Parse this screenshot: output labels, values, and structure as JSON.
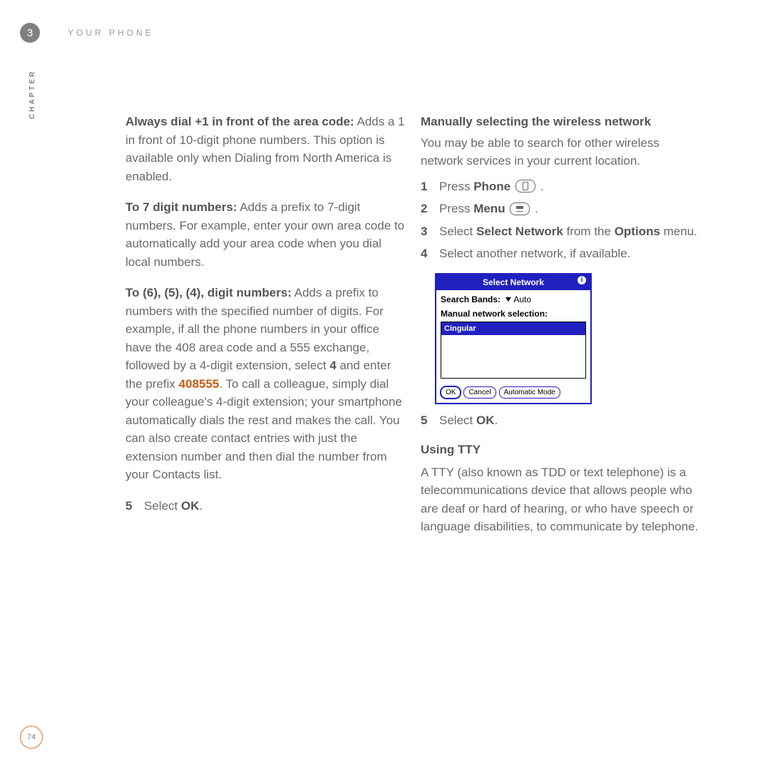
{
  "header": {
    "chapter_number": "3",
    "chapter_title": "YOUR PHONE",
    "side_label": "CHAPTER"
  },
  "page_number": "74",
  "left_column": {
    "p1_bold": "Always dial +1 in front of the area code:",
    "p1_rest": " Adds a 1 in front of 10-digit phone numbers. This option is available only when Dialing from North America is enabled.",
    "p2_bold": "To 7 digit numbers:",
    "p2_rest": " Adds a prefix to 7-digit numbers. For example, enter your own area code to automatically add your area code when you dial local numbers.",
    "p3_bold": "To (6), (5), (4), digit numbers:",
    "p3_rest_a": " Adds a prefix to numbers with the specified number of digits. For example, if all the phone numbers in your office have the 408 area code and a 555 exchange, followed by a 4-digit extension, select ",
    "p3_four": "4",
    "p3_rest_b": " and enter the prefix ",
    "p3_prefix": "408555",
    "p3_rest_c": ". To call a colleague, simply dial your colleague's 4-digit extension; your smartphone automatically dials the rest and makes the call. You can also create contact entries with just the extension number and then dial the number from your Contacts list.",
    "step5_num": "5",
    "step5_a": "Select ",
    "step5_b": "OK",
    "step5_c": "."
  },
  "right_column": {
    "heading1": "Manually selecting the wireless network",
    "intro1": "You may be able to search for other wireless network services in your current location.",
    "s1_num": "1",
    "s1_a": "Press ",
    "s1_b": "Phone",
    "s1_c": " .",
    "s2_num": "2",
    "s2_a": "Press ",
    "s2_b": "Menu",
    "s2_c": " .",
    "s3_num": "3",
    "s3_a": "Select ",
    "s3_b": "Select Network",
    "s3_c": " from the ",
    "s3_d": "Options",
    "s3_e": " menu.",
    "s4_num": "4",
    "s4_text": "Select another network, if available.",
    "s5_num": "5",
    "s5_a": "Select ",
    "s5_b": "OK",
    "s5_c": ".",
    "heading2": "Using TTY",
    "tty_para": "A TTY (also known as TDD or text telephone) is a telecommunications device that allows people who are deaf or hard of hearing, or who have speech or language disabilities, to communicate by telephone."
  },
  "mock": {
    "title": "Select Network",
    "info_glyph": "i",
    "row1_label": "Search Bands:",
    "row1_value": "Auto",
    "row2_label": "Manual network selection:",
    "list_selected": "Cingular",
    "btn_ok": "OK",
    "btn_cancel": "Cancel",
    "btn_auto": "Automatic Mode"
  }
}
